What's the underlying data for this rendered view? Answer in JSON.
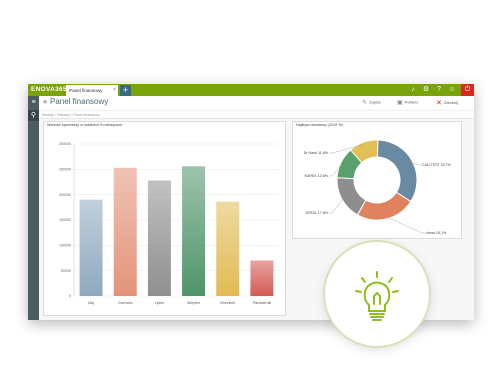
{
  "app": {
    "logo": "ENOVA365",
    "tab_label": "Panel finansowy",
    "tab_close": "×",
    "tab_add": "+",
    "top_icons": [
      "bell-icon",
      "gear-icon",
      "help-icon",
      "user-icon"
    ],
    "brand_color": "#7aa20b",
    "sidebar_color": "#4a5d63",
    "danger_color": "#d9291c"
  },
  "page": {
    "title": "Panel finansowy",
    "breadcrumb": "Moduły ›  Obszary  ›  Panel finansowy",
    "actions": [
      {
        "label": "Zapisz",
        "icon": "pencil-icon"
      },
      {
        "label": "Pobierz",
        "icon": "export-icon"
      },
      {
        "label": "Zamknij",
        "icon": "close-icon"
      }
    ]
  },
  "bar_panel_title": "Wartość sprzedaży w ostatnich 6 miesiącach",
  "pie_panel_title": "Najlepsi dostawcy (2019 %)",
  "chart_data": [
    {
      "type": "bar",
      "categories": [
        "Maj",
        "Czerwiec",
        "Lipiec",
        "Sierpień",
        "Wrzesień",
        "Październik"
      ],
      "values": [
        190000,
        253000,
        228000,
        256000,
        186000,
        70000
      ],
      "ylim": [
        0,
        300000
      ],
      "yticks": [
        "0",
        "50000",
        "100000",
        "150000",
        "200000",
        "250000",
        "300000"
      ],
      "colors": [
        "#8fa9bf",
        "#e4937a",
        "#8f8f8f",
        "#4e9468",
        "#e1bb52",
        "#d45a55"
      ],
      "grid": true
    },
    {
      "type": "pie",
      "slices": [
        {
          "label": "CAN TEST 33,7%",
          "value": 33.7,
          "color": "#6a8aa3"
        },
        {
          "label": "ulmar 24,1%",
          "value": 24.1,
          "color": "#e0825d"
        },
        {
          "label": "DRTAL 17,8%",
          "value": 17.8,
          "color": "#8e8e8e"
        },
        {
          "label": "KAREX 12,6%",
          "value": 12.6,
          "color": "#5aa06d"
        },
        {
          "label": "Dr Hand 11,8%",
          "value": 11.8,
          "color": "#e3c055"
        }
      ]
    }
  ]
}
